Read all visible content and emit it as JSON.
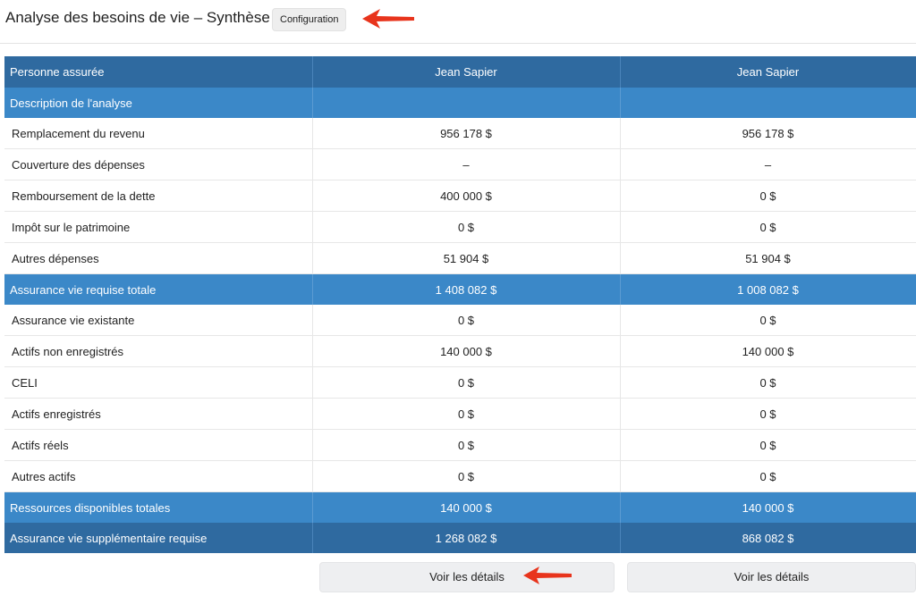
{
  "header": {
    "title": "Analyse des besoins de vie – Synthèse",
    "config_label": "Configuration"
  },
  "table": {
    "columns": [
      "Personne assurée",
      "Jean Sapier",
      "Jean Sapier"
    ],
    "rows": [
      {
        "type": "band",
        "cells": [
          "Description de l'analyse",
          "",
          ""
        ]
      },
      {
        "type": "row",
        "cells": [
          "Remplacement du revenu",
          "956 178 $",
          "956 178 $"
        ]
      },
      {
        "type": "row",
        "cells": [
          "Couverture des dépenses",
          "–",
          "–"
        ]
      },
      {
        "type": "row",
        "cells": [
          "Remboursement de la dette",
          "400 000 $",
          "0 $"
        ]
      },
      {
        "type": "row",
        "cells": [
          "Impôt sur le patrimoine",
          "0 $",
          "0 $"
        ]
      },
      {
        "type": "row",
        "cells": [
          "Autres dépenses",
          "51 904 $",
          "51 904 $"
        ]
      },
      {
        "type": "band",
        "cells": [
          "Assurance vie requise totale",
          "1 408 082 $",
          "1 008 082 $"
        ]
      },
      {
        "type": "row",
        "cells": [
          "Assurance vie existante",
          "0 $",
          "0 $"
        ]
      },
      {
        "type": "row",
        "cells": [
          "Actifs non enregistrés",
          "140 000 $",
          "140 000 $"
        ]
      },
      {
        "type": "row",
        "cells": [
          "CELI",
          "0 $",
          "0 $"
        ]
      },
      {
        "type": "row",
        "cells": [
          "Actifs enregistrés",
          "0 $",
          "0 $"
        ]
      },
      {
        "type": "row",
        "cells": [
          "Actifs réels",
          "0 $",
          "0 $"
        ]
      },
      {
        "type": "row",
        "cells": [
          "Autres actifs",
          "0 $",
          "0 $"
        ]
      },
      {
        "type": "band",
        "cells": [
          "Ressources disponibles totales",
          "140 000 $",
          "140 000 $"
        ]
      },
      {
        "type": "dark",
        "cells": [
          "Assurance vie supplémentaire requise",
          "1 268 082 $",
          "868 082 $"
        ]
      }
    ]
  },
  "footer": {
    "details_labels": [
      "Voir les détails",
      "Voir les détails"
    ]
  },
  "colors": {
    "header_bg": "#2f6aa0",
    "band_bg": "#3b88c8",
    "arrow": "#e8341c"
  },
  "icons": [
    "red-arrow-icon",
    "red-arrow-icon"
  ]
}
